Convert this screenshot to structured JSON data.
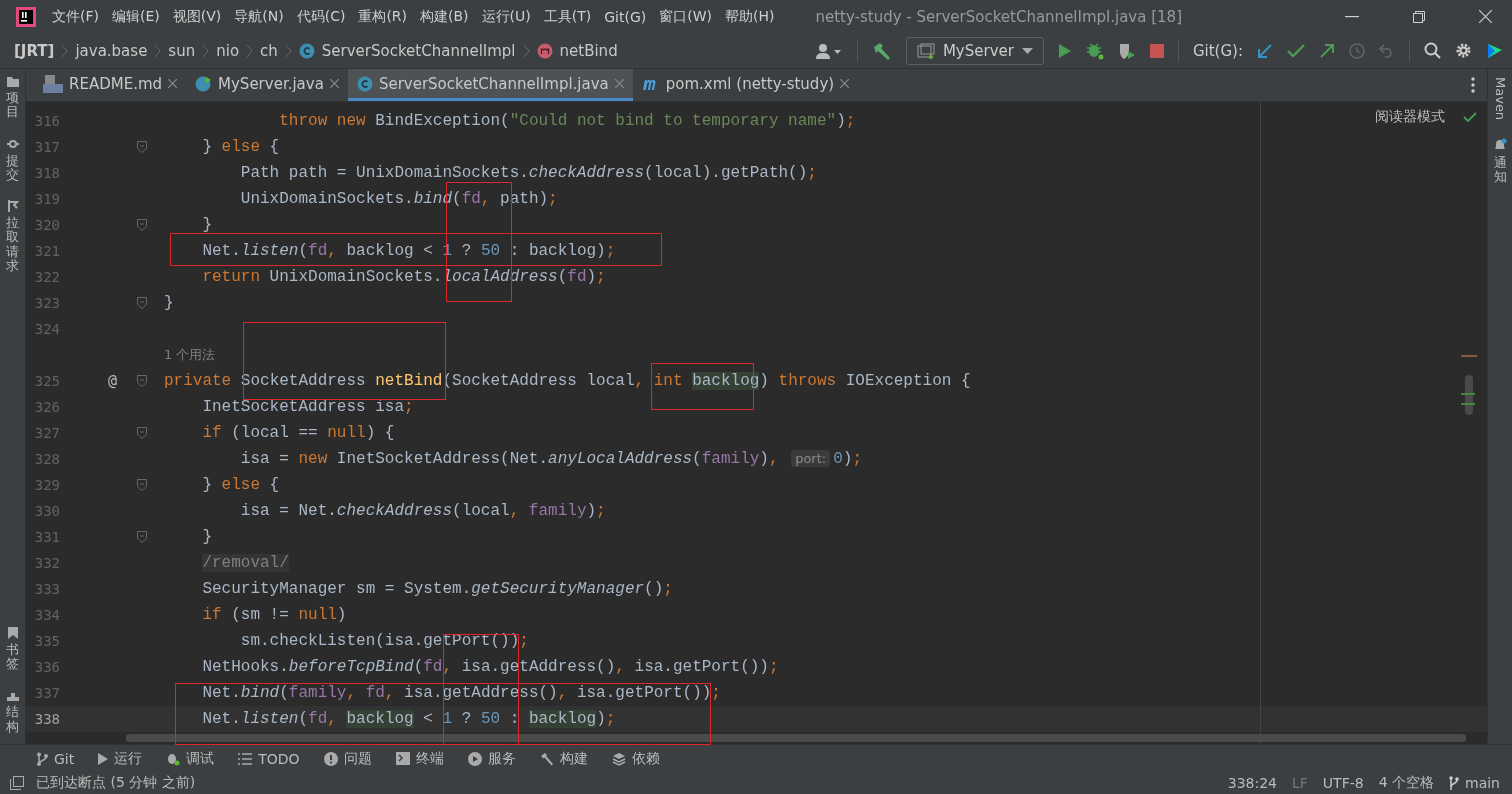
{
  "menu": [
    "文件(F)",
    "编辑(E)",
    "视图(V)",
    "导航(N)",
    "代码(C)",
    "重构(R)",
    "构建(B)",
    "运行(U)",
    "工具(T)",
    "Git(G)",
    "窗口(W)",
    "帮助(H)"
  ],
  "window": {
    "title": "netty-study - ServerSocketChannelImpl.java [18]"
  },
  "breadcrumbs": [
    {
      "label": "[JRT]",
      "kind": "root"
    },
    {
      "label": "java.base",
      "kind": "plain"
    },
    {
      "label": "sun",
      "kind": "plain"
    },
    {
      "label": "nio",
      "kind": "plain"
    },
    {
      "label": "ch",
      "kind": "plain"
    },
    {
      "label": "ServerSocketChannelImpl",
      "kind": "class"
    },
    {
      "label": "netBind",
      "kind": "method"
    }
  ],
  "toolbar": {
    "run_config": "MyServer",
    "git_label": "Git(G):"
  },
  "left_tools_top": [
    "项目",
    "提交",
    "拉取请求"
  ],
  "left_tools_bottom": [
    "书签",
    "结构"
  ],
  "right_tools": [
    {
      "label": "Maven",
      "kind": "latin"
    },
    {
      "label": "通知",
      "kind": "cjk"
    }
  ],
  "tabs": [
    {
      "label": "README.md",
      "kind": "markdown",
      "selected": false
    },
    {
      "label": "MyServer.java",
      "kind": "runnable",
      "selected": false
    },
    {
      "label": "ServerSocketChannelImpl.java",
      "kind": "class",
      "selected": true
    },
    {
      "label": "pom.xml (netty-study)",
      "kind": "maven",
      "selected": false
    }
  ],
  "reader_mode": "阅读器模式",
  "lines": [
    {
      "kind": "code",
      "number": "316",
      "fold": false,
      "current": false,
      "tokens": [
        {
          "text": "            throw",
          "kind": "kw"
        },
        {
          "text": " new",
          "kind": "kw"
        },
        {
          "text": " BindException(",
          "kind": "plain"
        },
        {
          "text": "\"Could not bind to temporary name\"",
          "kind": "str"
        },
        {
          "text": ")",
          "kind": "plain"
        },
        {
          "text": ";",
          "kind": "punct"
        }
      ]
    },
    {
      "kind": "code",
      "number": "317",
      "fold": true,
      "current": false,
      "tokens": [
        {
          "text": "    } ",
          "kind": "plain"
        },
        {
          "text": "else",
          "kind": "kw"
        },
        {
          "text": " {",
          "kind": "plain"
        }
      ]
    },
    {
      "kind": "code",
      "number": "318",
      "fold": false,
      "current": false,
      "tokens": [
        {
          "text": "        Path path = UnixDomainSockets.",
          "kind": "plain"
        },
        {
          "text": "checkAddress",
          "kind": "call"
        },
        {
          "text": "(local).getPath()",
          "kind": "plain"
        },
        {
          "text": ";",
          "kind": "punct"
        }
      ]
    },
    {
      "kind": "code",
      "number": "319",
      "fold": false,
      "current": false,
      "tokens": [
        {
          "text": "        UnixDomainSockets.",
          "kind": "plain"
        },
        {
          "text": "bind",
          "kind": "call"
        },
        {
          "text": "(",
          "kind": "plain"
        },
        {
          "text": "fd",
          "kind": "field"
        },
        {
          "text": ",",
          "kind": "punct"
        },
        {
          "text": " path)",
          "kind": "plain"
        },
        {
          "text": ";",
          "kind": "punct"
        }
      ]
    },
    {
      "kind": "code",
      "number": "320",
      "fold": true,
      "current": false,
      "tokens": [
        {
          "text": "    }",
          "kind": "plain"
        }
      ]
    },
    {
      "kind": "code",
      "number": "321",
      "fold": false,
      "current": false,
      "tokens": [
        {
          "text": "    Net.",
          "kind": "plain"
        },
        {
          "text": "listen",
          "kind": "call"
        },
        {
          "text": "(",
          "kind": "plain"
        },
        {
          "text": "fd",
          "kind": "field"
        },
        {
          "text": ",",
          "kind": "punct"
        },
        {
          "text": " backlog < ",
          "kind": "plain"
        },
        {
          "text": "1",
          "kind": "num"
        },
        {
          "text": " ? ",
          "kind": "plain"
        },
        {
          "text": "50",
          "kind": "num"
        },
        {
          "text": " : backlog)",
          "kind": "plain"
        },
        {
          "text": ";",
          "kind": "punct"
        }
      ]
    },
    {
      "kind": "code",
      "number": "322",
      "fold": false,
      "current": false,
      "tokens": [
        {
          "text": "    return",
          "kind": "kw"
        },
        {
          "text": " UnixDomainSockets.",
          "kind": "plain"
        },
        {
          "text": "localAddress",
          "kind": "call"
        },
        {
          "text": "(",
          "kind": "plain"
        },
        {
          "text": "fd",
          "kind": "field"
        },
        {
          "text": ")",
          "kind": "plain"
        },
        {
          "text": ";",
          "kind": "punct"
        }
      ]
    },
    {
      "kind": "code",
      "number": "323",
      "fold": true,
      "current": false,
      "tokens": [
        {
          "text": "}",
          "kind": "plain"
        }
      ]
    },
    {
      "kind": "code",
      "number": "324",
      "fold": false,
      "current": false
    },
    {
      "kind": "usage",
      "text": "1 个用法"
    },
    {
      "kind": "code",
      "number": "325",
      "marker": "@",
      "fold": true,
      "current": false,
      "tokens": [
        {
          "text": "private",
          "kind": "kw"
        },
        {
          "text": " SocketAddress ",
          "kind": "plain"
        },
        {
          "text": "netBind",
          "kind": "decl"
        },
        {
          "text": "(SocketAddress local",
          "kind": "plain"
        },
        {
          "text": ",",
          "kind": "punct"
        },
        {
          "text": " int ",
          "kind": "kw"
        },
        {
          "text": "backlog",
          "kind": "usage"
        },
        {
          "text": ") ",
          "kind": "plain"
        },
        {
          "text": "throws",
          "kind": "kw"
        },
        {
          "text": " IOException {",
          "kind": "plain"
        }
      ]
    },
    {
      "kind": "code",
      "number": "326",
      "fold": false,
      "current": false,
      "tokens": [
        {
          "text": "    InetSocketAddress isa",
          "kind": "plain"
        },
        {
          "text": ";",
          "kind": "punct"
        }
      ]
    },
    {
      "kind": "code",
      "number": "327",
      "fold": true,
      "current": false,
      "tokens": [
        {
          "text": "    if",
          "kind": "kw"
        },
        {
          "text": " (local == ",
          "kind": "plain"
        },
        {
          "text": "null",
          "kind": "kw"
        },
        {
          "text": ") {",
          "kind": "plain"
        }
      ]
    },
    {
      "kind": "code",
      "number": "328",
      "fold": false,
      "current": false,
      "tokens": [
        {
          "text": "        isa = ",
          "kind": "plain"
        },
        {
          "text": "new",
          "kind": "kw"
        },
        {
          "text": " InetSocketAddress(Net.",
          "kind": "plain"
        },
        {
          "text": "anyLocalAddress",
          "kind": "call"
        },
        {
          "text": "(",
          "kind": "plain"
        },
        {
          "text": "family",
          "kind": "field"
        },
        {
          "text": ")",
          "kind": "plain"
        },
        {
          "text": ", ",
          "kind": "punct"
        },
        {
          "text": "port:",
          "kind": "hint"
        },
        {
          "text": "0",
          "kind": "num"
        },
        {
          "text": ")",
          "kind": "plain"
        },
        {
          "text": ";",
          "kind": "punct"
        }
      ]
    },
    {
      "kind": "code",
      "number": "329",
      "fold": true,
      "current": false,
      "tokens": [
        {
          "text": "    } ",
          "kind": "plain"
        },
        {
          "text": "else",
          "kind": "kw"
        },
        {
          "text": " {",
          "kind": "plain"
        }
      ]
    },
    {
      "kind": "code",
      "number": "330",
      "fold": false,
      "current": false,
      "tokens": [
        {
          "text": "        isa = Net.",
          "kind": "plain"
        },
        {
          "text": "checkAddress",
          "kind": "call"
        },
        {
          "text": "(local",
          "kind": "plain"
        },
        {
          "text": ",",
          "kind": "punct"
        },
        {
          "text": " family",
          "kind": "field"
        },
        {
          "text": ")",
          "kind": "plain"
        },
        {
          "text": ";",
          "kind": "punct"
        }
      ]
    },
    {
      "kind": "code",
      "number": "331",
      "fold": true,
      "current": false,
      "tokens": [
        {
          "text": "    }",
          "kind": "plain"
        }
      ]
    },
    {
      "kind": "code",
      "number": "332",
      "fold": false,
      "current": false,
      "tokens": [
        {
          "text": "/removal/",
          "kind": "comment"
        }
      ]
    },
    {
      "kind": "code",
      "number": "333",
      "fold": false,
      "current": false,
      "tokens": [
        {
          "text": "    SecurityManager sm = System.",
          "kind": "plain"
        },
        {
          "text": "getSecurityManager",
          "kind": "call"
        },
        {
          "text": "()",
          "kind": "plain"
        },
        {
          "text": ";",
          "kind": "punct"
        }
      ]
    },
    {
      "kind": "code",
      "number": "334",
      "fold": false,
      "current": false,
      "tokens": [
        {
          "text": "    if",
          "kind": "kw"
        },
        {
          "text": " (sm != ",
          "kind": "plain"
        },
        {
          "text": "null",
          "kind": "kw"
        },
        {
          "text": ")",
          "kind": "plain"
        }
      ]
    },
    {
      "kind": "code",
      "number": "335",
      "fold": false,
      "current": false,
      "tokens": [
        {
          "text": "        sm.checkListen(isa.getPort())",
          "kind": "plain"
        },
        {
          "text": ";",
          "kind": "punct"
        }
      ]
    },
    {
      "kind": "code",
      "number": "336",
      "fold": false,
      "current": false,
      "tokens": [
        {
          "text": "    NetHooks.",
          "kind": "plain"
        },
        {
          "text": "beforeTcpBind",
          "kind": "call"
        },
        {
          "text": "(",
          "kind": "plain"
        },
        {
          "text": "fd",
          "kind": "field"
        },
        {
          "text": ",",
          "kind": "punct"
        },
        {
          "text": " isa.getAddress()",
          "kind": "plain"
        },
        {
          "text": ",",
          "kind": "punct"
        },
        {
          "text": " isa.getPort())",
          "kind": "plain"
        },
        {
          "text": ";",
          "kind": "punct"
        }
      ]
    },
    {
      "kind": "code",
      "number": "337",
      "fold": false,
      "current": false,
      "tokens": [
        {
          "text": "    Net.",
          "kind": "plain"
        },
        {
          "text": "bind",
          "kind": "call"
        },
        {
          "text": "(",
          "kind": "plain"
        },
        {
          "text": "family",
          "kind": "field"
        },
        {
          "text": ",",
          "kind": "punct"
        },
        {
          "text": " fd",
          "kind": "field"
        },
        {
          "text": ",",
          "kind": "punct"
        },
        {
          "text": " isa.getAddress()",
          "kind": "plain"
        },
        {
          "text": ",",
          "kind": "punct"
        },
        {
          "text": " isa.getPort())",
          "kind": "plain"
        },
        {
          "text": ";",
          "kind": "punct"
        }
      ]
    },
    {
      "kind": "code",
      "number": "338",
      "fold": false,
      "current": true,
      "tokens": [
        {
          "text": "    Net.",
          "kind": "plain"
        },
        {
          "text": "listen",
          "kind": "call"
        },
        {
          "text": "(",
          "kind": "plain"
        },
        {
          "text": "fd",
          "kind": "field"
        },
        {
          "text": ", ",
          "kind": "punct"
        },
        {
          "text": "backlog",
          "kind": "usage"
        },
        {
          "text": " < ",
          "kind": "plain"
        },
        {
          "text": "1",
          "kind": "num"
        },
        {
          "text": " ? ",
          "kind": "plain"
        },
        {
          "text": "50",
          "kind": "num"
        },
        {
          "text": " : ",
          "kind": "plain"
        },
        {
          "text": "backlog",
          "kind": "usage"
        },
        {
          "text": ")",
          "kind": "plain"
        },
        {
          "text": ";",
          "kind": "punct"
        }
      ]
    }
  ],
  "tool_windows": [
    "Git",
    "运行",
    "调试",
    "TODO",
    "问题",
    "终端",
    "服务",
    "构建",
    "依赖"
  ],
  "status_bar": {
    "message": "已到达断点 (5 分钟 之前)",
    "position": "338:24",
    "line_ending": "LF",
    "encoding": "UTF-8",
    "indent": "4 个空格",
    "branch": "main"
  }
}
